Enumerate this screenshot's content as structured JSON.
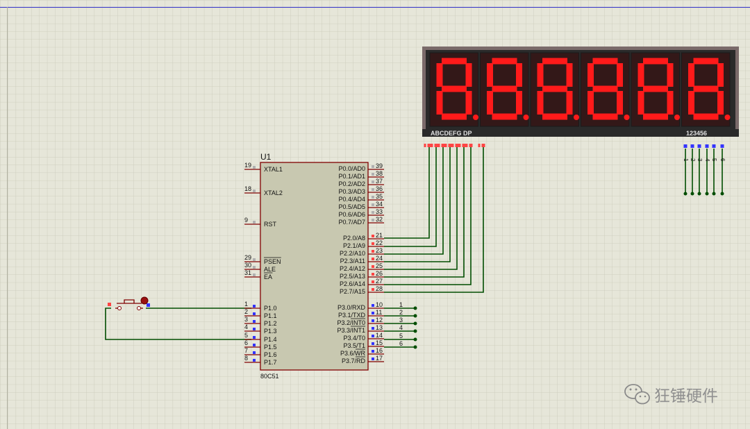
{
  "chip": {
    "ref": "U1",
    "part": "80C51",
    "left_pins": [
      {
        "num": "19",
        "name": "XTAL1"
      },
      {
        "num": "18",
        "name": "XTAL2"
      },
      {
        "num": "9",
        "name": "RST"
      },
      {
        "num": "29",
        "name": "PSEN"
      },
      {
        "num": "30",
        "name": "ALE"
      },
      {
        "num": "31",
        "name": "EA"
      },
      {
        "num": "1",
        "name": "P1.0"
      },
      {
        "num": "2",
        "name": "P1.1"
      },
      {
        "num": "3",
        "name": "P1.2"
      },
      {
        "num": "4",
        "name": "P1.3"
      },
      {
        "num": "5",
        "name": "P1.4"
      },
      {
        "num": "6",
        "name": "P1.5"
      },
      {
        "num": "7",
        "name": "P1.6"
      },
      {
        "num": "8",
        "name": "P1.7"
      }
    ],
    "right_pins": [
      {
        "num": "39",
        "name": "P0.0/AD0"
      },
      {
        "num": "38",
        "name": "P0.1/AD1"
      },
      {
        "num": "37",
        "name": "P0.2/AD2"
      },
      {
        "num": "36",
        "name": "P0.3/AD3"
      },
      {
        "num": "35",
        "name": "P0.4/AD4"
      },
      {
        "num": "34",
        "name": "P0.5/AD5"
      },
      {
        "num": "33",
        "name": "P0.6/AD6"
      },
      {
        "num": "32",
        "name": "P0.7/AD7"
      },
      {
        "num": "21",
        "name": "P2.0/A8"
      },
      {
        "num": "22",
        "name": "P2.1/A9"
      },
      {
        "num": "23",
        "name": "P2.2/A10"
      },
      {
        "num": "24",
        "name": "P2.3/A11"
      },
      {
        "num": "25",
        "name": "P2.4/A12"
      },
      {
        "num": "26",
        "name": "P2.5/A13"
      },
      {
        "num": "27",
        "name": "P2.6/A14"
      },
      {
        "num": "28",
        "name": "P2.7/A15"
      },
      {
        "num": "10",
        "name": "P3.0/RXD"
      },
      {
        "num": "11",
        "name": "P3.1/TXD"
      },
      {
        "num": "12",
        "name": "P3.2/INT0"
      },
      {
        "num": "13",
        "name": "P3.3/INT1"
      },
      {
        "num": "14",
        "name": "P3.4/T0"
      },
      {
        "num": "15",
        "name": "P3.5/T1"
      },
      {
        "num": "16",
        "name": "P3.6/WR"
      },
      {
        "num": "17",
        "name": "P3.7/RD"
      }
    ]
  },
  "display": {
    "digit_count": 6,
    "segment_label": "ABCDEFG DP",
    "digit_label": "123456",
    "segment_color": "#ff1a1a",
    "digit_select_labels": [
      "1",
      "2",
      "3",
      "4",
      "5",
      "6"
    ]
  },
  "net_labels": [
    "1",
    "2",
    "3",
    "4",
    "5",
    "6"
  ],
  "watermark": "狂锤硬件",
  "colors": {
    "wire": "#004d00",
    "chip_body": "#c8c8b0",
    "pin": "#800000",
    "grid_bg": "#e6e6d9",
    "display_bg": "#2a2a2a"
  }
}
